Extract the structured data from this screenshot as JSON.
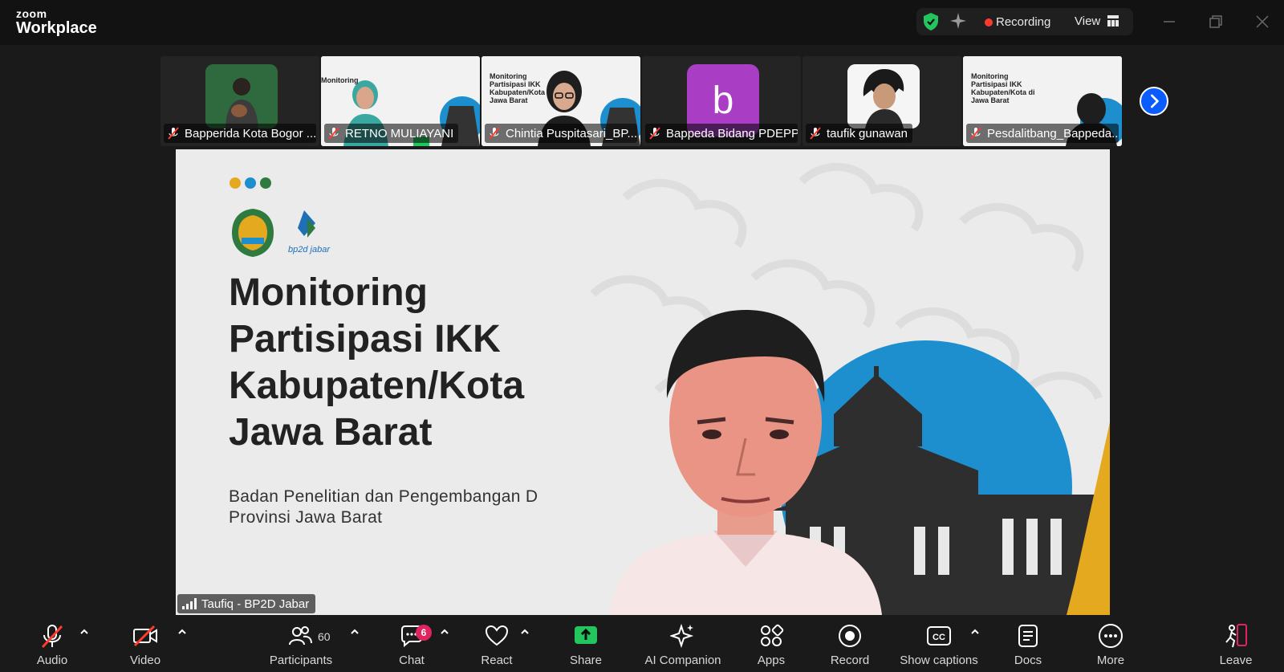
{
  "app": {
    "brand_line1": "zoom",
    "brand_line2": "Workplace"
  },
  "topbar": {
    "recording_label": "Recording",
    "view_label": "View",
    "accent_red": "#ff3b30",
    "accent_green": "#22c55e"
  },
  "gallery": {
    "participants": [
      {
        "name": "Bapperida Kota Bogor ...",
        "muted": true
      },
      {
        "name": "RETNO MULIAYANI",
        "muted": true
      },
      {
        "name": "Chintia Puspitasari_BP...",
        "muted": true
      },
      {
        "name": "Bappeda Bidang PDEPP",
        "muted": true,
        "avatar_letter": "b",
        "avatar_color": "#a93ec4"
      },
      {
        "name": "taufik gunawan",
        "muted": true
      },
      {
        "name": "Pesdalitbang_Bappeda...",
        "muted": true
      }
    ],
    "thumb_slide_text": [
      "Monitoring",
      "Partisipasi IKK",
      "Kabupaten/Kota di",
      "Jawa Barat"
    ]
  },
  "stage": {
    "logo_text": "bp2d jabar",
    "slide_title": [
      "Monitoring",
      "Partisipasi IKK",
      "Kabupaten/Kota",
      "Jawa Barat"
    ],
    "slide_subtitle": [
      "Badan Penelitian dan Pengembangan D",
      "Provinsi Jawa Barat"
    ],
    "speaker_name": "Taufiq - BP2D Jabar"
  },
  "toolbar": {
    "audio_label": "Audio",
    "video_label": "Video",
    "participants_label": "Participants",
    "participants_count": "60",
    "chat_label": "Chat",
    "chat_badge": "6",
    "react_label": "React",
    "share_label": "Share",
    "ai_label": "AI Companion",
    "apps_label": "Apps",
    "record_label": "Record",
    "captions_label": "Show captions",
    "docs_label": "Docs",
    "more_label": "More",
    "leave_label": "Leave",
    "share_color": "#22c55e",
    "leave_color": "#e0245e"
  }
}
